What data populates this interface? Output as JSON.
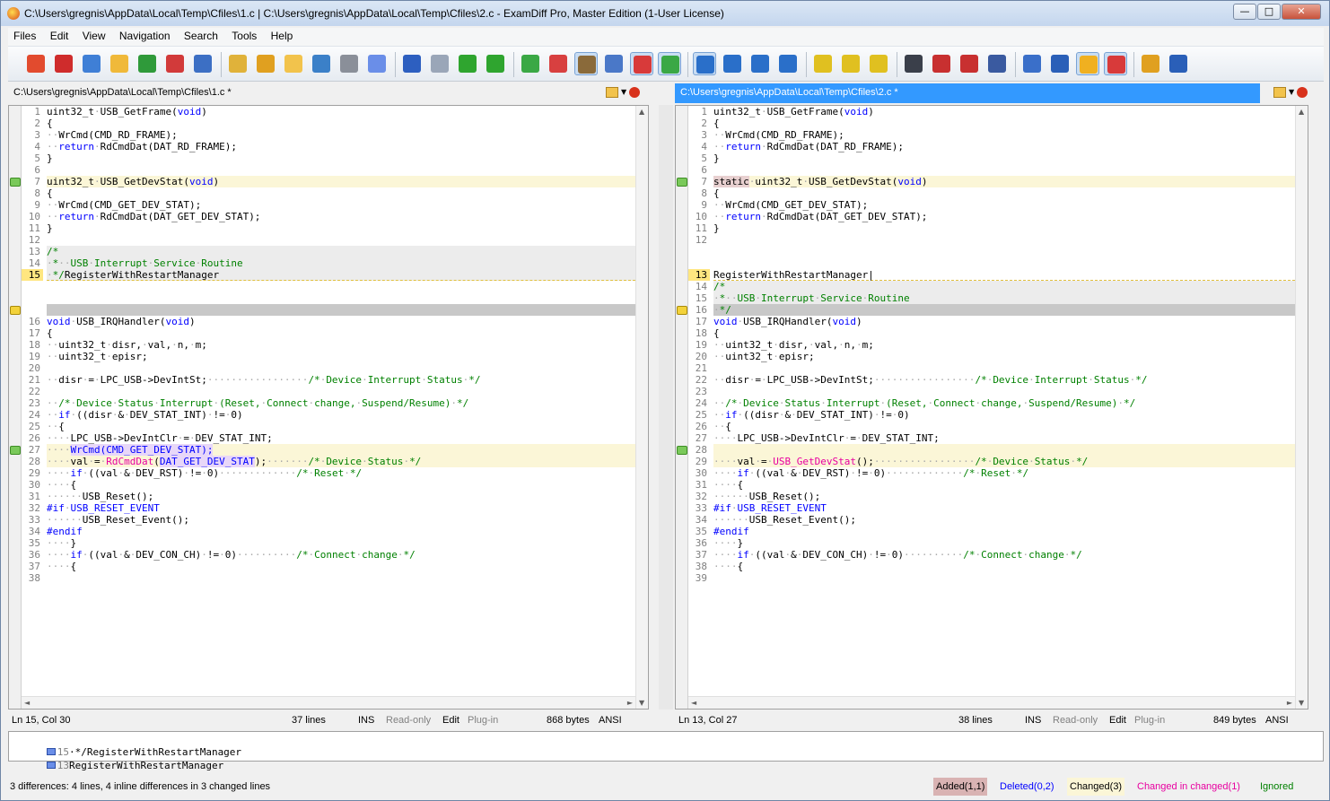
{
  "window": {
    "title": "C:\\Users\\gregnis\\AppData\\Local\\Temp\\Cfiles\\1.c  |  C:\\Users\\gregnis\\AppData\\Local\\Temp\\Cfiles\\2.c - ExamDiff Pro, Master Edition (1-User License)",
    "min_label": "—",
    "max_label": "□",
    "close_label": "✕"
  },
  "menu": [
    "Files",
    "Edit",
    "View",
    "Navigation",
    "Search",
    "Tools",
    "Help"
  ],
  "toolbar_icons": [
    "compare-icon",
    "cherries-icon",
    "recompare-icon",
    "open-folder-icon",
    "save-left-icon",
    "save-right-icon",
    "save-all-icon",
    "edit-left-icon",
    "edit-right-icon",
    "merge-left-icon",
    "merge-right-icon",
    "print-icon",
    "print-preview-icon",
    "undo-icon",
    "redo-icon",
    "next-arrow-icon",
    "prev-arrow-icon",
    "view-horizontal-icon",
    "view-red-icon",
    "view-columns-icon",
    "view-grid-icon",
    "show-diff-icon",
    "checkmark-icon",
    "filter-icon",
    "filter2-icon",
    "filter3-icon",
    "filter4-icon",
    "prev-diff-icon",
    "current-diff-icon",
    "next-diff-icon",
    "find-icon",
    "find-next-icon",
    "find-prev-icon",
    "replace-icon",
    "list-icon",
    "text-lines-icon",
    "highlight-icon",
    "edit-options-icon",
    "settings-icon",
    "binary-icon"
  ],
  "left": {
    "path": "C:\\Users\\gregnis\\AppData\\Local\\Temp\\Cfiles\\1.c *",
    "status": {
      "position": "Ln 15, Col 30",
      "lines": "37 lines",
      "ins": "INS",
      "readonly": "Read-only",
      "edit": "Edit",
      "plugin": "Plug-in",
      "bytes": "868 bytes",
      "encoding": "ANSI"
    }
  },
  "right": {
    "path": "C:\\Users\\gregnis\\AppData\\Local\\Temp\\Cfiles\\2.c *",
    "status": {
      "position": "Ln 13, Col 27",
      "lines": "38 lines",
      "ins": "INS",
      "readonly": "Read-only",
      "edit": "Edit",
      "plugin": "Plug-in",
      "bytes": "849 bytes",
      "encoding": "ANSI"
    }
  },
  "compare_lines": [
    {
      "num": "15",
      "text": "·*/RegisterWithRestartManager"
    },
    {
      "num": "13",
      "text": "RegisterWithRestartManager"
    }
  ],
  "summary": "3 differences: 4 lines, 4 inline differences in 3 changed lines",
  "legend": {
    "added": "Added(1,1)",
    "deleted": "Deleted(0,2)",
    "changed": "Changed(3)",
    "changed_in_changed": "Changed in changed(1)",
    "ignored": "Ignored"
  },
  "colors": {
    "added": "#d9b3b3",
    "deleted_text": "#0000ff",
    "changed": "#fbf6d7",
    "changed_in_changed_text": "#e800a0",
    "ignored_text": "#008000"
  }
}
